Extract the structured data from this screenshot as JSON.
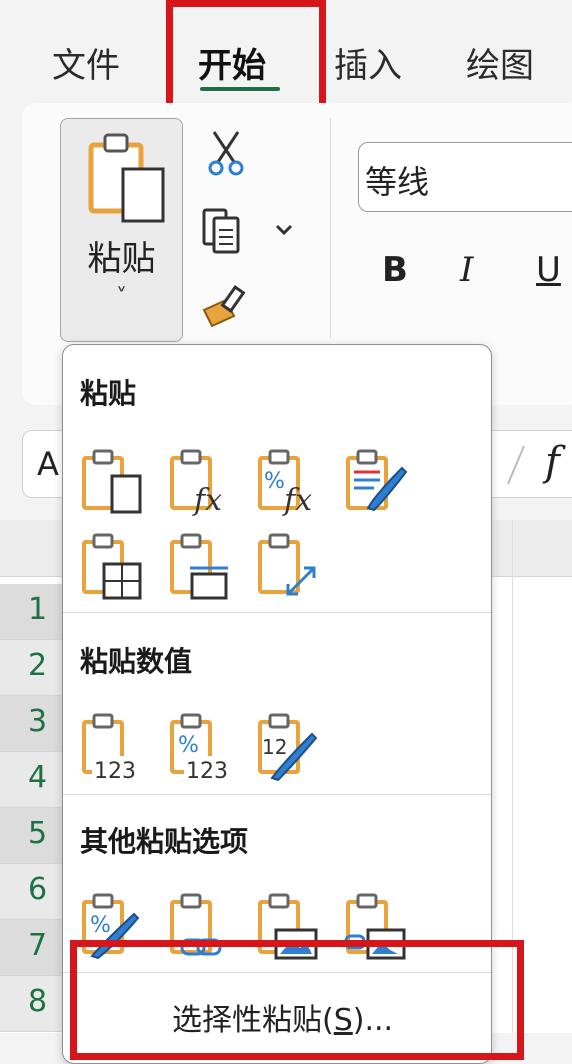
{
  "ribbon_tabs": [
    {
      "label": "文件"
    },
    {
      "label": "开始"
    },
    {
      "label": "插入"
    },
    {
      "label": "绘图"
    }
  ],
  "clipboard": {
    "paste_label": "粘贴",
    "chevron": "˅"
  },
  "font": {
    "name": "等线",
    "bold": "B",
    "italic": "I",
    "underline": "U"
  },
  "formula": {
    "name_box_partial": "A",
    "fx": "f"
  },
  "rows": [
    "1",
    "2",
    "3",
    "4",
    "5",
    "6",
    "7",
    "8"
  ],
  "paste_menu": {
    "section_paste": "粘贴",
    "section_values": "粘贴数值",
    "section_other": "其他粘贴选项",
    "paste_special_prefix": "选择性粘贴(",
    "paste_special_key": "S",
    "paste_special_suffix": ")..."
  },
  "colors": {
    "accent_green": "#1e7145",
    "highlight_red": "#d7161c",
    "clipboard_orange": "#e8a33c",
    "icon_blue": "#2f7fd1"
  }
}
